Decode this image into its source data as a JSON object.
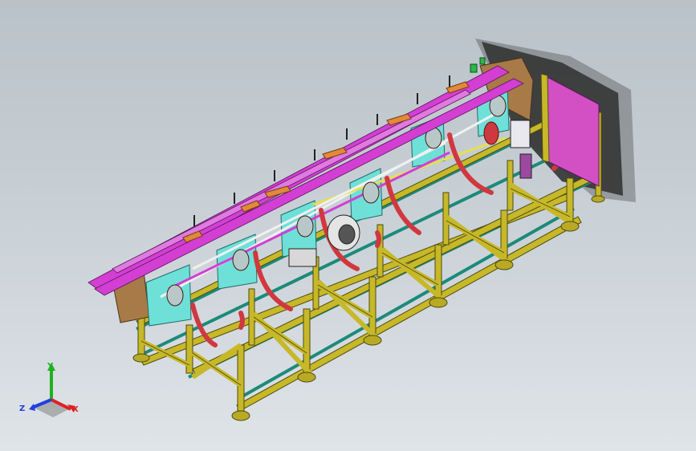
{
  "viewport": {
    "background_top": "#b9c2c8",
    "background_bottom": "#dfe4e8"
  },
  "model": {
    "frame_color": "#c7b829",
    "frame_edge_color": "#4e4a10",
    "rail_color": "#1c8a7a",
    "beam_color": "#d33ed3",
    "bracket_color": "#6ee0d8",
    "belt_color": "#d03840",
    "wood_color": "#a87a48",
    "panel_color": "#d34fc4",
    "shadow_color": "#2a2a2a"
  },
  "triad": {
    "x_label": "X",
    "y_label": "Y",
    "z_label": "Z",
    "x_color": "#e02020",
    "y_color": "#20b020",
    "z_color": "#2040e0"
  }
}
